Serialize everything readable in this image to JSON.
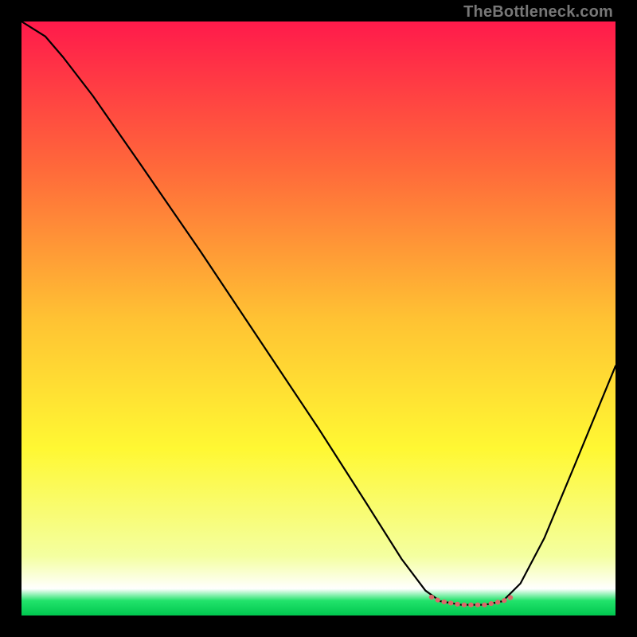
{
  "watermark": "TheBottleneck.com",
  "chart_data": {
    "type": "line",
    "title": "",
    "xlabel": "",
    "ylabel": "",
    "xlim": [
      0,
      100
    ],
    "ylim": [
      0,
      100
    ],
    "background_gradient": {
      "stops": [
        {
          "offset": 0.0,
          "color": "#ff1a4b"
        },
        {
          "offset": 0.25,
          "color": "#ff6a3a"
        },
        {
          "offset": 0.5,
          "color": "#ffc233"
        },
        {
          "offset": 0.72,
          "color": "#fff833"
        },
        {
          "offset": 0.9,
          "color": "#f4ffa0"
        },
        {
          "offset": 0.955,
          "color": "#ffffff"
        },
        {
          "offset": 0.975,
          "color": "#22e36b"
        },
        {
          "offset": 1.0,
          "color": "#00c74f"
        }
      ]
    },
    "series": [
      {
        "name": "bottleneck-curve",
        "color": "#000000",
        "width": 2.2,
        "points": [
          {
            "x": 0.0,
            "y": 100.0
          },
          {
            "x": 4.0,
            "y": 97.5
          },
          {
            "x": 7.0,
            "y": 94.0
          },
          {
            "x": 12.0,
            "y": 87.5
          },
          {
            "x": 20.0,
            "y": 76.0
          },
          {
            "x": 30.0,
            "y": 61.5
          },
          {
            "x": 40.0,
            "y": 46.5
          },
          {
            "x": 50.0,
            "y": 31.5
          },
          {
            "x": 58.0,
            "y": 19.0
          },
          {
            "x": 64.0,
            "y": 9.5
          },
          {
            "x": 68.0,
            "y": 4.2
          },
          {
            "x": 70.5,
            "y": 2.4
          },
          {
            "x": 74.0,
            "y": 1.8
          },
          {
            "x": 78.0,
            "y": 1.8
          },
          {
            "x": 81.0,
            "y": 2.4
          },
          {
            "x": 84.0,
            "y": 5.4
          },
          {
            "x": 88.0,
            "y": 13.0
          },
          {
            "x": 93.0,
            "y": 25.0
          },
          {
            "x": 100.0,
            "y": 42.0
          }
        ]
      },
      {
        "name": "optimal-range-marker",
        "color": "#d86a6a",
        "width": 6,
        "points": [
          {
            "x": 69.0,
            "y": 3.1
          },
          {
            "x": 70.5,
            "y": 2.4
          },
          {
            "x": 74.0,
            "y": 1.8
          },
          {
            "x": 78.0,
            "y": 1.8
          },
          {
            "x": 81.0,
            "y": 2.4
          },
          {
            "x": 82.5,
            "y": 3.1
          }
        ]
      }
    ]
  }
}
